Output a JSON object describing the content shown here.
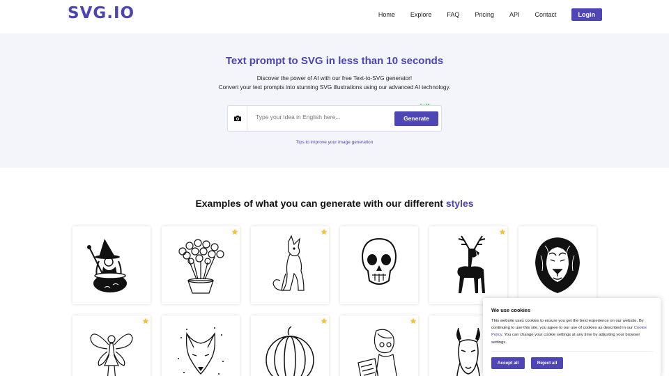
{
  "brand": {
    "logo": "SVG.IO",
    "accent": "#4f46b5"
  },
  "nav": {
    "items": [
      "Home",
      "Explore",
      "FAQ",
      "Pricing",
      "API",
      "Contact"
    ],
    "login_label": "Login"
  },
  "hero": {
    "title": "Text prompt to SVG in less than 10 seconds",
    "subtitle_line1": "Discover the power of AI with our free Text-to-SVG generator!",
    "subtitle_line2": "Convert your text prompts into stunning SVG illustrations using our advanced AI technology.",
    "prompt_placeholder": "Type your idea in English here...",
    "prompt_value": "",
    "char_counter": "0 / 35",
    "generate_label": "Generate",
    "tips_link": "Tips to improve your image generation"
  },
  "examples": {
    "title_prefix": "Examples of what you can generate with our different ",
    "title_accent": "styles",
    "cards": [
      {
        "subject": "witch-with-cauldron",
        "starred": false
      },
      {
        "subject": "flower-bouquet-in-pot",
        "starred": true
      },
      {
        "subject": "sitting-dog",
        "starred": true
      },
      {
        "subject": "skull",
        "starred": false
      },
      {
        "subject": "deer-silhouette",
        "starred": true
      },
      {
        "subject": "lion-head",
        "starred": false
      },
      {
        "subject": "fairy",
        "starred": true
      },
      {
        "subject": "fox-head",
        "starred": false
      },
      {
        "subject": "pumpkin",
        "starred": true
      },
      {
        "subject": "girl-reading-book",
        "starred": true
      },
      {
        "subject": "llama-head",
        "starred": false
      }
    ]
  },
  "cookie": {
    "title": "We use cookies",
    "text_before_link": "This website uses cookies to ensure you get the best experience on our website. By continuing to use this site, you agree to our use of cookies as described in our ",
    "link_text": "Cookie Policy",
    "text_after_link": ". You can change your cookie settings at any time by adjusting your browser settings.",
    "accept_label": "Accept all",
    "reject_label": "Reject all"
  },
  "icons": {
    "camera": "camera-icon",
    "star": "star-icon",
    "star_color": "#f2c230"
  }
}
